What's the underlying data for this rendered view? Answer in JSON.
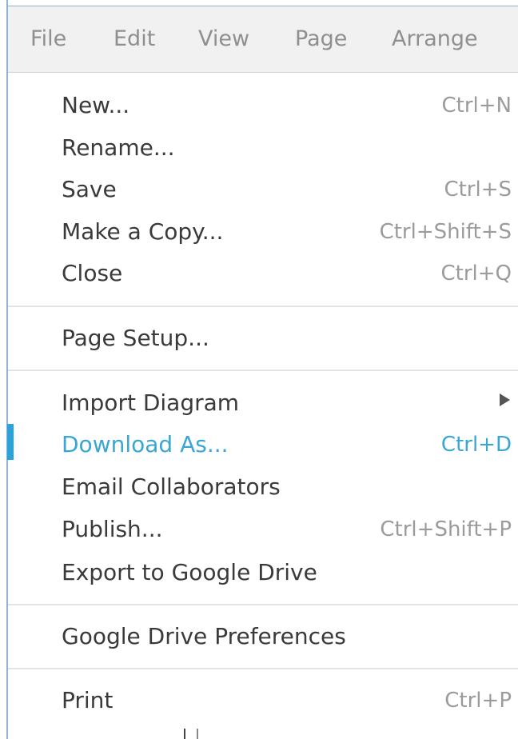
{
  "menubar": {
    "items": [
      {
        "label": "File"
      },
      {
        "label": "Edit"
      },
      {
        "label": "View"
      },
      {
        "label": "Page"
      },
      {
        "label": "Arrange"
      }
    ]
  },
  "file_menu": {
    "items": [
      {
        "label": "New...",
        "shortcut": "Ctrl+N"
      },
      {
        "label": "Rename...",
        "shortcut": ""
      },
      {
        "label": "Save",
        "shortcut": "Ctrl+S"
      },
      {
        "label": "Make a Copy...",
        "shortcut": "Ctrl+Shift+S"
      },
      {
        "label": "Close",
        "shortcut": "Ctrl+Q"
      },
      {
        "label": "Page Setup...",
        "shortcut": ""
      },
      {
        "label": "Import Diagram",
        "shortcut": "",
        "submenu": true
      },
      {
        "label": "Download As...",
        "shortcut": "Ctrl+D",
        "highlighted": true
      },
      {
        "label": "Email Collaborators",
        "shortcut": ""
      },
      {
        "label": "Publish...",
        "shortcut": "Ctrl+Shift+P"
      },
      {
        "label": "Export to Google Drive",
        "shortcut": ""
      },
      {
        "label": "Google Drive Preferences",
        "shortcut": ""
      },
      {
        "label": "Print",
        "shortcut": "Ctrl+P"
      }
    ]
  },
  "colors": {
    "highlight": "#3aa6d6",
    "active_bar": "#29a3d9",
    "menubar_bg": "#f1f1f1",
    "label_text": "#3a3a3a",
    "shortcut_text": "#9b9b9b"
  }
}
